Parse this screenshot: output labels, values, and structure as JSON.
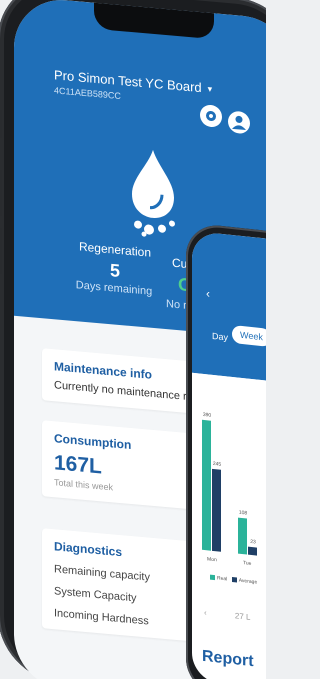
{
  "header": {
    "board_title": "Pro Simon Test YC Board",
    "board_id": "4C11AEB589CC",
    "caret": "▾"
  },
  "icons": {
    "settings": "gear-icon",
    "account": "avatar-icon",
    "logo": "water-drop-icon"
  },
  "stats": {
    "regeneration": {
      "label": "Regeneration",
      "value": "5",
      "sub": "Days remaining"
    },
    "current": {
      "label": "Curre",
      "value": "O",
      "sub": "No m re"
    }
  },
  "cards": {
    "maintenance": {
      "title": "Maintenance info",
      "body": "Currently no maintenance requ"
    },
    "consumption": {
      "title": "Consumption",
      "value": "167L",
      "sub": "Total this week"
    },
    "diagnostics": {
      "title": "Diagnostics",
      "rows": [
        "Remaining capacity",
        "System Capacity",
        "Incoming Hardness"
      ]
    }
  },
  "second_phone": {
    "back": "‹",
    "tabs": {
      "day": "Day",
      "week": "Week"
    },
    "legend": {
      "real": "Real",
      "average": "Average"
    },
    "date_prefix": "‹",
    "date_text": "27 L",
    "report_title": "Report"
  },
  "chart_data": {
    "type": "bar",
    "categories": [
      "Mon",
      "Tue"
    ],
    "series": [
      {
        "name": "Real",
        "values": [
          390,
          108
        ]
      },
      {
        "name": "Average",
        "values": [
          245,
          23
        ]
      }
    ],
    "data_labels": [
      "390",
      "245",
      "108",
      "2"
    ],
    "colors": {
      "Real": "#2bb39a",
      "Average": "#1f3f66"
    },
    "ylim": [
      0,
      420
    ]
  },
  "colors": {
    "brand_blue": "#1f6fb8",
    "accent_green": "#4fd08c",
    "title_blue": "#1f5fa3"
  }
}
